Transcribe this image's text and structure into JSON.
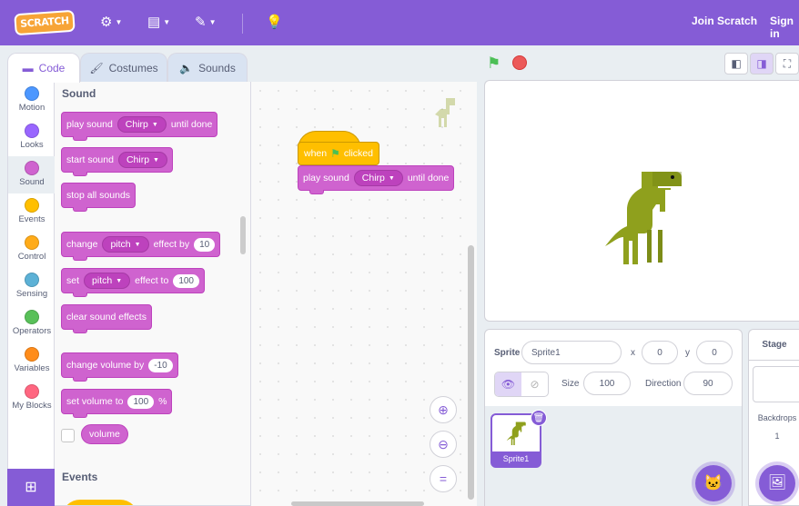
{
  "menubar": {
    "logo_text": "SCRATCH",
    "join_label": "Join Scratch",
    "signin_label": "Sign in"
  },
  "tabs": [
    {
      "label": "Code",
      "icon": "code-icon",
      "active": true
    },
    {
      "label": "Costumes",
      "icon": "brush-icon",
      "active": false
    },
    {
      "label": "Sounds",
      "icon": "speaker-icon",
      "active": false
    }
  ],
  "categories": [
    {
      "label": "Motion",
      "color": "#4c97ff"
    },
    {
      "label": "Looks",
      "color": "#9966ff"
    },
    {
      "label": "Sound",
      "color": "#cf63cf"
    },
    {
      "label": "Events",
      "color": "#ffbf00"
    },
    {
      "label": "Control",
      "color": "#ffab19"
    },
    {
      "label": "Sensing",
      "color": "#5cb1d6"
    },
    {
      "label": "Operators",
      "color": "#59c059"
    },
    {
      "label": "Variables",
      "color": "#ff8c1a"
    },
    {
      "label": "My Blocks",
      "color": "#ff6680"
    }
  ],
  "palette": {
    "section_sound": "Sound",
    "section_events": "Events",
    "play_sound": "play sound",
    "until_done": "until done",
    "start_sound": "start sound",
    "sound_name": "Chirp",
    "stop_all_sounds": "stop all sounds",
    "change": "change",
    "effect_by": "effect by",
    "effect_by_value": "10",
    "set": "set",
    "effect_to": "effect to",
    "effect_to_value": "100",
    "effect_name": "pitch",
    "clear_sound_effects": "clear sound effects",
    "change_volume_by": "change volume by",
    "change_volume_value": "-10",
    "set_volume_to": "set volume to",
    "set_volume_value": "100",
    "percent": "%",
    "volume": "volume"
  },
  "script": {
    "when": "when",
    "clicked": "clicked",
    "play_sound": "play sound",
    "sound_name": "Chirp",
    "until_done": "until done"
  },
  "sprite_info": {
    "sprite_label": "Sprite",
    "sprite_name": "Sprite1",
    "x_label": "x",
    "x_value": "0",
    "y_label": "y",
    "y_value": "0",
    "size_label": "Size",
    "size_value": "100",
    "direction_label": "Direction",
    "direction_value": "90"
  },
  "sprite_list": [
    {
      "name": "Sprite1",
      "selected": true
    }
  ],
  "stage_pane": {
    "title": "Stage",
    "backdrops_label": "Backdrops",
    "backdrops_count": "1"
  },
  "colors": {
    "accent": "#855cd6",
    "sound": "#cf63cf",
    "events": "#ffbf00",
    "dino": "#8fa01d"
  }
}
